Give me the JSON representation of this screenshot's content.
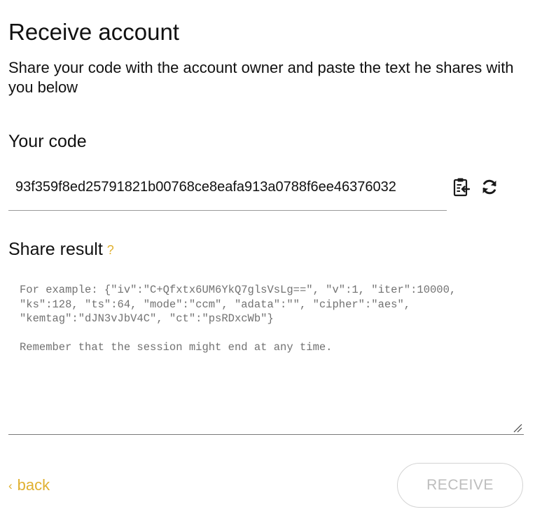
{
  "page": {
    "title": "Receive account",
    "description": "Share your code with the account owner and paste the text he shares with you below"
  },
  "your_code": {
    "label": "Your code",
    "value": "93f359f8ed25791821b00768ce8eafa913a0788f6ee46376032",
    "copy_icon": "clipboard-copy-icon",
    "refresh_icon": "refresh-icon"
  },
  "share_result": {
    "label": "Share result",
    "help": "?",
    "value": "",
    "placeholder": "For example: {\"iv\":\"C+Qfxtx6UM6YkQ7glsVsLg==\", \"v\":1, \"iter\":10000, \"ks\":128, \"ts\":64, \"mode\":\"ccm\", \"adata\":\"\", \"cipher\":\"aes\", \"kemtag\":\"dJN3vJbV4C\", \"ct\":\"psRDxcWb\"}\n\nRemember that the session might end at any time."
  },
  "footer": {
    "back_label": "back",
    "back_chevron": "‹",
    "receive_label": "RECEIVE"
  },
  "colors": {
    "accent": "#e0b030",
    "text": "#111111",
    "placeholder": "#727272",
    "disabled": "#bdbdbd"
  }
}
